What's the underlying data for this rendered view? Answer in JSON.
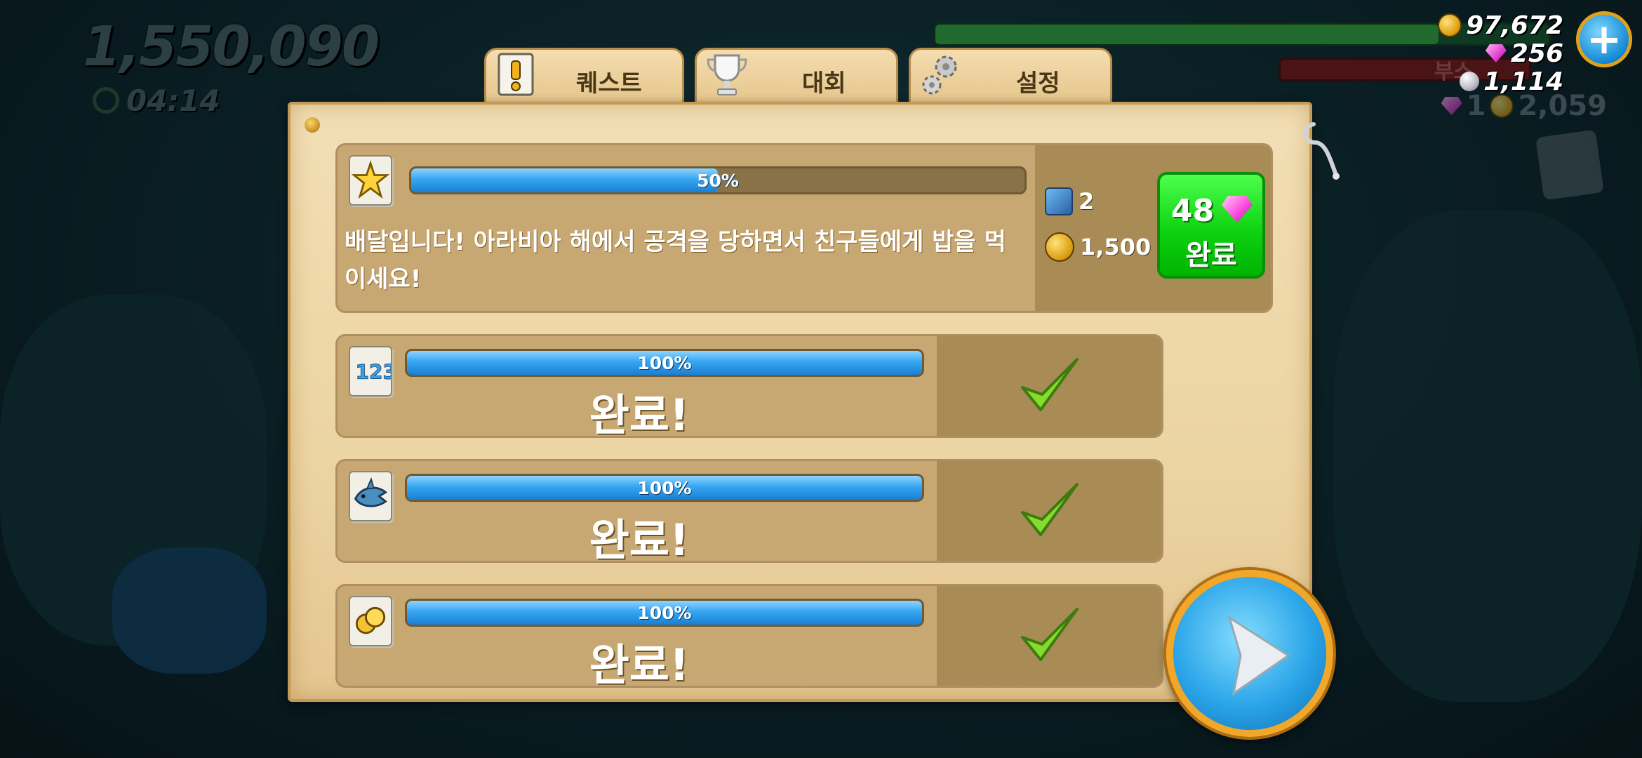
{
  "hud": {
    "score": "1,550,090",
    "timer": "04:14",
    "coins": "97,672",
    "gems": "256",
    "pearls": "1,114",
    "boost_label": "부스",
    "side_gems": "1",
    "side_coins": "2,059"
  },
  "tabs": [
    {
      "label": "퀘스트",
      "icon": "quest-scroll-icon",
      "active": true
    },
    {
      "label": "대회",
      "icon": "trophy-icon",
      "active": false
    },
    {
      "label": "설정",
      "icon": "gears-icon",
      "active": false
    }
  ],
  "quests": [
    {
      "icon": "starfish-icon",
      "progress": 50,
      "progress_text": "50%",
      "description": "배달입니다! 아라비아 해에서 공격을 당하면서 친구들에게 밥을 먹이세요!",
      "reward_skill": "2",
      "reward_coins": "1,500",
      "complete_cost": "48",
      "complete_label": "완료"
    },
    {
      "icon": "numbers-123-icon",
      "progress": 100,
      "progress_text": "100%",
      "status": "완료!"
    },
    {
      "icon": "shark-icon",
      "progress": 100,
      "progress_text": "100%",
      "status": "완료!"
    },
    {
      "icon": "coins-icon",
      "progress": 100,
      "progress_text": "100%",
      "status": "완료!"
    }
  ],
  "colors": {
    "progress_blue": "#2a9be8",
    "complete_green": "#16d618",
    "parchment": "#ecd4a3",
    "check_green": "#7bd12a"
  }
}
